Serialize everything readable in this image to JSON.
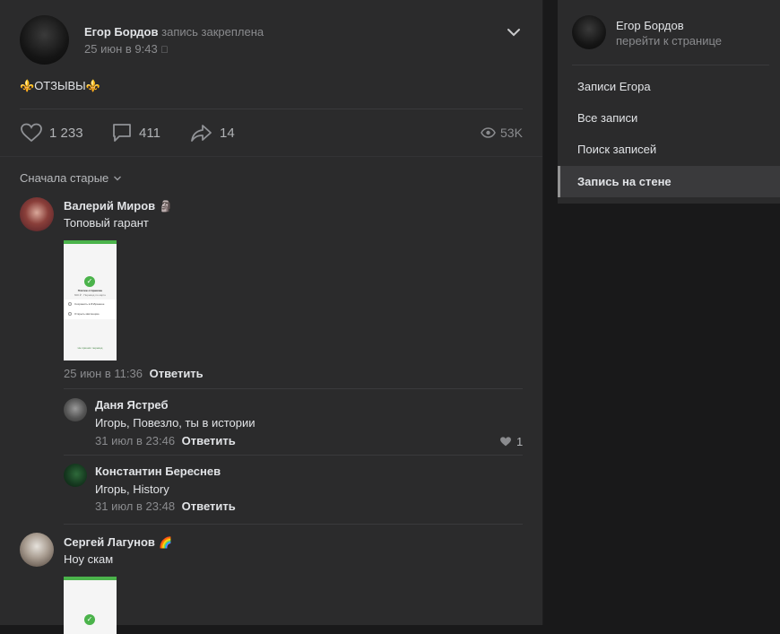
{
  "post": {
    "author": "Егор Бордов",
    "pinned_note": "запись закреплена",
    "date": "25 июн в 9:43",
    "text_left_emoji": "⚜️",
    "text": "ОТЗЫВЫ",
    "text_right_emoji": "⚜️",
    "likes": "1 233",
    "comments": "411",
    "shares": "14",
    "views": "53K",
    "sort_label": "Сначала старые"
  },
  "comments": [
    {
      "author": "Валерий Миров",
      "badge": "🗿",
      "text": "Топовый гарант",
      "date": "25 июн в 11:36",
      "reply": "Ответить"
    },
    {
      "author": "Даня Ястреб",
      "text": "Игорь, Повезло, ты в истории",
      "date": "31 июл в 23:46",
      "reply": "Ответить",
      "likes": "1"
    },
    {
      "author": "Константин Береснев",
      "text": "Игорь, History",
      "date": "31 июл в 23:48",
      "reply": "Ответить"
    },
    {
      "author": "Сергей Лагунов",
      "badge": "🌈",
      "text": "Ноу скам"
    }
  ],
  "screenshot_text": {
    "title": "Платеж отправлен",
    "subtitle": "600 ₽ · Перевод по карте",
    "row1": "Сохранить в Избранное",
    "row2": "Открыть квитанцию",
    "footer": "Не пришёл перевод"
  },
  "sidebar": {
    "author": "Егор Бордов",
    "goto": "перейти к странице",
    "items": [
      {
        "label": "Записи Егора"
      },
      {
        "label": "Все записи"
      },
      {
        "label": "Поиск записей"
      },
      {
        "label": "Запись на стене"
      }
    ]
  }
}
